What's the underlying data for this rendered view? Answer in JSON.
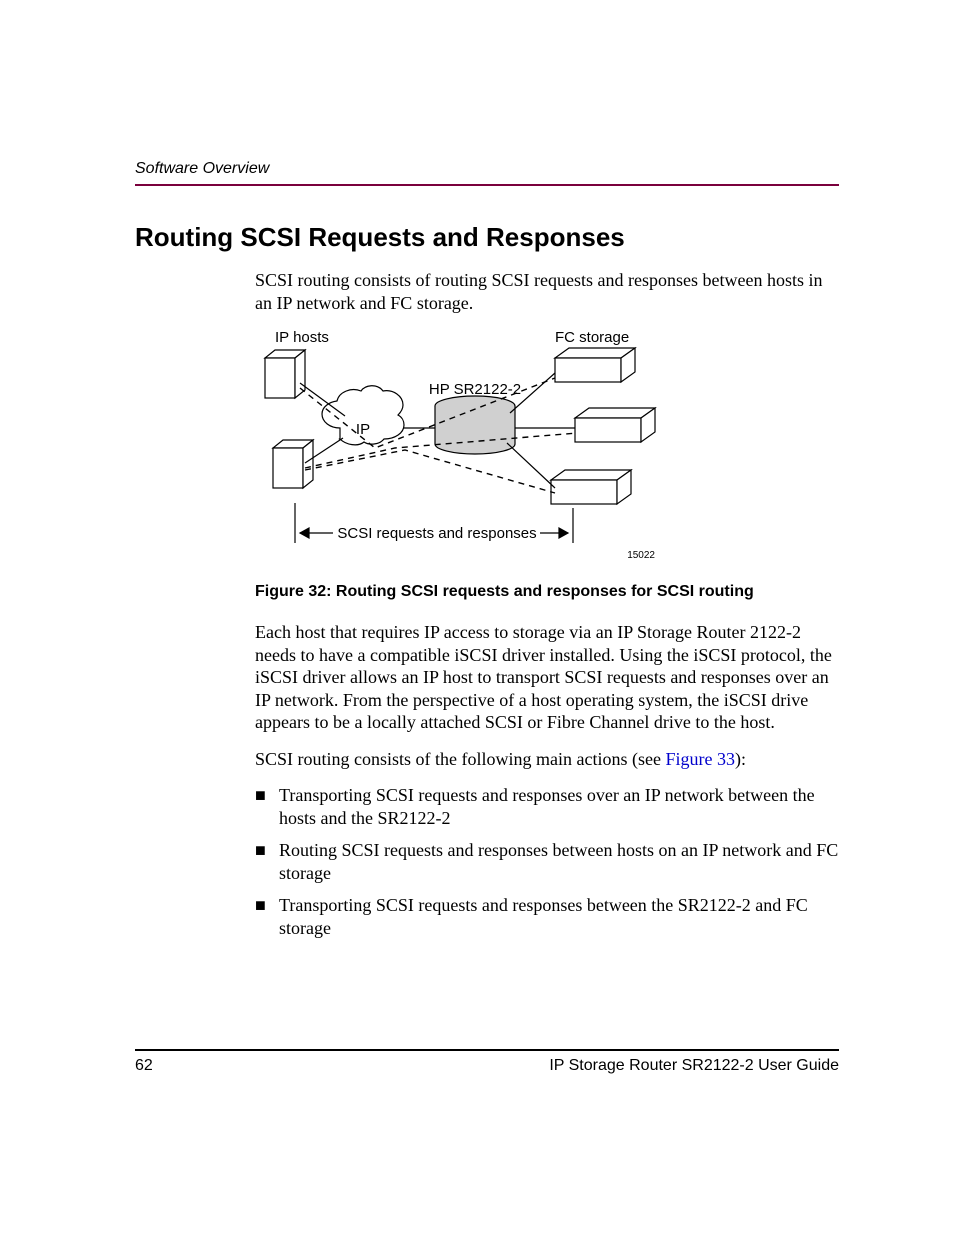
{
  "header": {
    "running_head": "Software Overview"
  },
  "heading": "Routing SCSI Requests and Responses",
  "intro": "SCSI routing consists of routing SCSI requests and responses between hosts in an IP network and FC storage.",
  "diagram": {
    "label_ip_hosts": "IP hosts",
    "label_fc_storage": "FC storage",
    "label_device": "HP SR2122-2",
    "label_ip_cloud": "IP",
    "label_scsi": "SCSI requests and responses",
    "id": "15022"
  },
  "figure_caption": "Figure 32:  Routing SCSI requests and responses for SCSI routing",
  "para2": "Each host that requires IP access to storage via an IP Storage Router 2122-2 needs to have a compatible iSCSI driver installed. Using the iSCSI protocol, the iSCSI driver allows an IP host to transport SCSI requests and responses over an IP network. From the perspective of a host operating system, the iSCSI drive appears to be a locally attached SCSI or Fibre Channel drive to the host.",
  "para3_a": "SCSI routing consists of the following main actions (see ",
  "para3_link": "Figure 33",
  "para3_b": "):",
  "bullets": [
    "Transporting SCSI requests and responses over an IP network between the hosts and the SR2122-2",
    "Routing SCSI requests and responses between hosts on an IP network and FC storage",
    "Transporting SCSI requests and responses between the SR2122-2 and FC storage"
  ],
  "footer": {
    "page_number": "62",
    "doc_title": "IP Storage Router SR2122-2 User Guide"
  }
}
